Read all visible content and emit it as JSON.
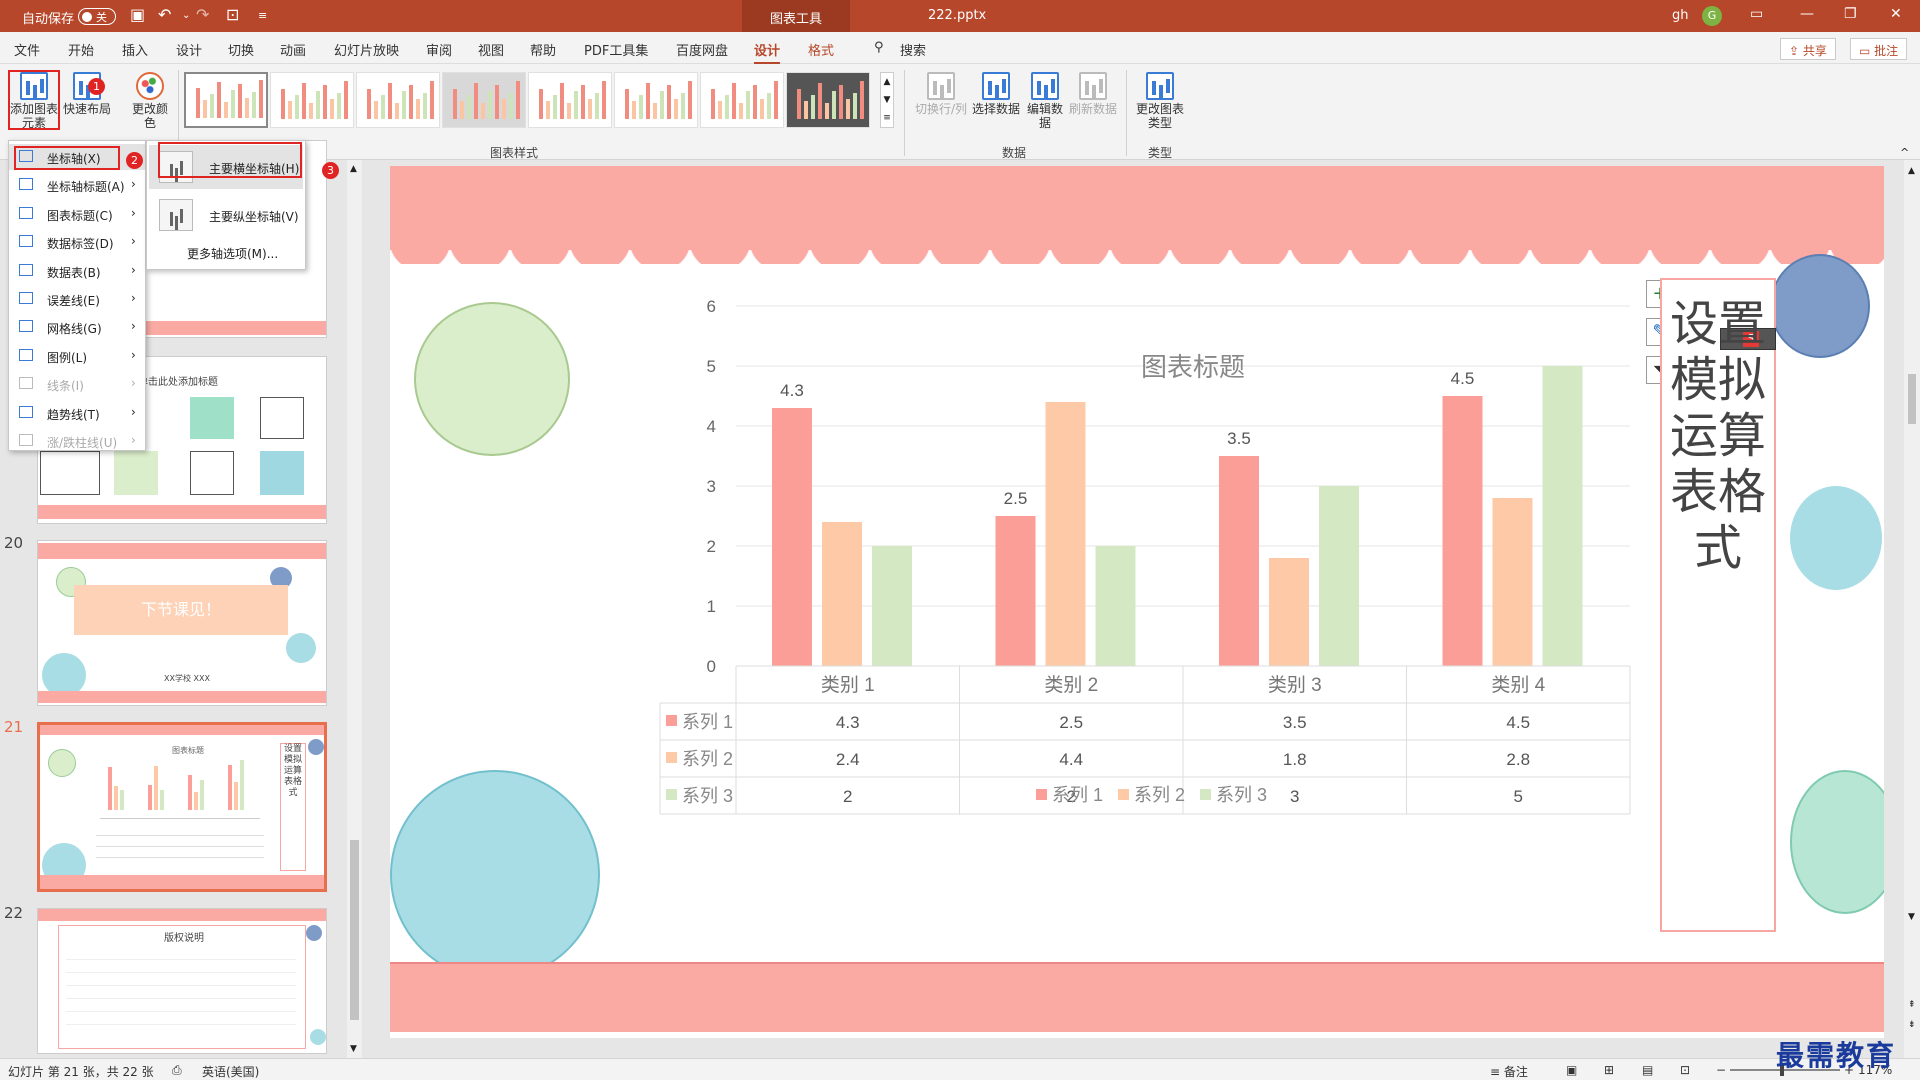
{
  "titlebar": {
    "autosave_label": "自动保存",
    "autosave_state": "关",
    "context_tab": "图表工具",
    "filename": "222.pptx",
    "user": "gh",
    "avatar_letter": "G"
  },
  "tabs": [
    "文件",
    "开始",
    "插入",
    "设计",
    "切换",
    "动画",
    "幻灯片放映",
    "审阅",
    "视图",
    "帮助",
    "PDF工具集",
    "百度网盘",
    "设计",
    "格式"
  ],
  "search_label": "搜索",
  "share_label": "共享",
  "comment_label": "批注",
  "ribbon": {
    "add_element": "添加图表元素",
    "quick_layout": "快速布局",
    "change_color": "更改颜色",
    "styles_group": "图表样式",
    "switch_rowcol": "切换行/列",
    "select_data": "选择数据",
    "edit_data": "编辑数据",
    "refresh_data": "刷新数据",
    "data_group": "数据",
    "change_type": "更改图表类型",
    "type_group": "类型"
  },
  "badges": [
    "1",
    "2",
    "3"
  ],
  "menu": {
    "items": [
      {
        "label": "坐标轴(X)",
        "enabled": true
      },
      {
        "label": "坐标轴标题(A)",
        "enabled": true
      },
      {
        "label": "图表标题(C)",
        "enabled": true
      },
      {
        "label": "数据标签(D)",
        "enabled": true
      },
      {
        "label": "数据表(B)",
        "enabled": true
      },
      {
        "label": "误差线(E)",
        "enabled": true
      },
      {
        "label": "网格线(G)",
        "enabled": true
      },
      {
        "label": "图例(L)",
        "enabled": true
      },
      {
        "label": "线条(I)",
        "enabled": false
      },
      {
        "label": "趋势线(T)",
        "enabled": true
      },
      {
        "label": "涨/跌柱线(U)",
        "enabled": false
      }
    ],
    "submenu": [
      "主要横坐标轴(H)",
      "主要纵坐标轴(V)",
      "更多轴选项(M)..."
    ]
  },
  "thumbs": {
    "nums": [
      "20",
      "21",
      "22"
    ],
    "t20_text": "下节课见！",
    "t20_school": "XX学校 XXX",
    "t21_title": "图表标题",
    "t21_side": "设置模拟运算表格式",
    "t22_title": "版权说明",
    "t19_header": "单击此处添加标题"
  },
  "slide": {
    "vertical_title": "设置模拟运算表格式"
  },
  "chart_data": {
    "type": "bar",
    "title": "图表标题",
    "categories": [
      "类别 1",
      "类别 2",
      "类别 3",
      "类别 4"
    ],
    "series": [
      {
        "name": "系列 1",
        "values": [
          4.3,
          2.5,
          3.5,
          4.5
        ],
        "color": "#fb9e97"
      },
      {
        "name": "系列 2",
        "values": [
          2.4,
          4.4,
          1.8,
          2.8
        ],
        "color": "#fdc9a7"
      },
      {
        "name": "系列 3",
        "values": [
          2,
          2,
          3,
          5
        ],
        "color": "#d5e8c4"
      }
    ],
    "data_labels_series1": [
      "4.3",
      "2.5",
      "3.5",
      "4.5"
    ],
    "ylim": [
      0,
      6
    ],
    "yticks": [
      "0",
      "1",
      "2",
      "3",
      "4",
      "5",
      "6"
    ],
    "grid": true,
    "data_table": true,
    "legend": "bottom"
  },
  "status": {
    "slide_info": "幻灯片 第 21 张，共 22 张",
    "language": "英语(美国)",
    "notes": "备注",
    "zoom": "117%"
  },
  "watermark": "最需教育",
  "colors": {
    "accent": "#b7472a",
    "highlight_box": "#e02424",
    "pink": "#fbaaa3"
  }
}
